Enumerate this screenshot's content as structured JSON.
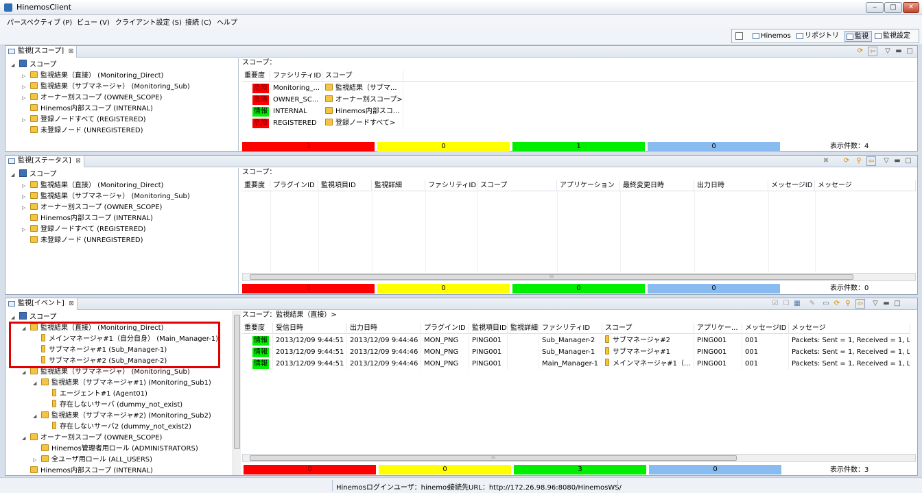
{
  "window": {
    "title": "HinemosClient",
    "min": "‒",
    "max": "□",
    "close": "✕"
  },
  "menu": [
    "パースペクティブ (P)",
    "ビュー (V)",
    "クライアント設定 (S)",
    "接続 (C)",
    "ヘルプ"
  ],
  "perspectives": [
    {
      "label": "Hinemos",
      "active": false
    },
    {
      "label": "リポジトリ",
      "active": false
    },
    {
      "label": "監視",
      "active": true
    },
    {
      "label": "監視設定",
      "active": false
    }
  ],
  "colors": {
    "critical": "#ff0000",
    "warning": "#ffff00",
    "info": "#00ee00",
    "unknown": "#88bbf0"
  },
  "view_close": "⊠",
  "scope_view": {
    "tab": "監視[スコープ]",
    "scope_label": "スコープ：",
    "tree": [
      {
        "label": "スコープ",
        "level": 0,
        "twist": "◢",
        "icon": "root"
      },
      {
        "label": "監視結果（直接） (Monitoring_Direct)",
        "level": 1,
        "twist": "▷",
        "icon": "folder"
      },
      {
        "label": "監視結果（サブマネージャ） (Monitoring_Sub)",
        "level": 1,
        "twist": "▷",
        "icon": "folder"
      },
      {
        "label": "オーナー別スコープ (OWNER_SCOPE)",
        "level": 1,
        "twist": "▷",
        "icon": "folder"
      },
      {
        "label": "Hinemos内部スコープ (INTERNAL)",
        "level": 1,
        "twist": "",
        "icon": "folder"
      },
      {
        "label": "登録ノードすべて (REGISTERED)",
        "level": 1,
        "twist": "▷",
        "icon": "folder"
      },
      {
        "label": "未登録ノード (UNREGISTERED)",
        "level": 1,
        "twist": "",
        "icon": "folder"
      }
    ],
    "columns": [
      "重要度",
      "ファシリティID",
      "スコープ"
    ],
    "rows": [
      {
        "severity": "危険",
        "sev_class": "red",
        "facility": "Monitoring_...",
        "scope": "監視結果（サブマ..."
      },
      {
        "severity": "危険",
        "sev_class": "red",
        "facility": "OWNER_SC...",
        "scope": "オーナー別スコープ>"
      },
      {
        "severity": "情報",
        "sev_class": "green",
        "facility": "INTERNAL",
        "scope": "Hinemos内部スコ..."
      },
      {
        "severity": "危険",
        "sev_class": "red",
        "facility": "REGISTERED",
        "scope": "登録ノードすべて>"
      }
    ],
    "counts": [
      "3",
      "0",
      "1",
      "0"
    ],
    "count_label": "表示件数：4"
  },
  "status_view": {
    "tab": "監視[ステータス]",
    "scope_label": "スコープ：",
    "tree": [
      {
        "label": "スコープ",
        "level": 0,
        "twist": "◢",
        "icon": "root"
      },
      {
        "label": "監視結果（直接） (Monitoring_Direct)",
        "level": 1,
        "twist": "▷",
        "icon": "folder"
      },
      {
        "label": "監視結果（サブマネージャ） (Monitoring_Sub)",
        "level": 1,
        "twist": "▷",
        "icon": "folder"
      },
      {
        "label": "オーナー別スコープ (OWNER_SCOPE)",
        "level": 1,
        "twist": "▷",
        "icon": "folder"
      },
      {
        "label": "Hinemos内部スコープ (INTERNAL)",
        "level": 1,
        "twist": "",
        "icon": "folder"
      },
      {
        "label": "登録ノードすべて (REGISTERED)",
        "level": 1,
        "twist": "▷",
        "icon": "folder"
      },
      {
        "label": "未登録ノード (UNREGISTERED)",
        "level": 1,
        "twist": "",
        "icon": "folder"
      }
    ],
    "columns": [
      "重要度",
      "プラグインID",
      "監視項目ID",
      "監視詳細",
      "ファシリティID",
      "スコープ",
      "アプリケーション",
      "最終変更日時",
      "出力日時",
      "メッセージID",
      "メッセージ"
    ],
    "counts": [
      "0",
      "0",
      "0",
      "0"
    ],
    "count_label": "表示件数：0",
    "scroll_thumb": "⁞⁞⁞"
  },
  "event_view": {
    "tab": "監視[イベント]",
    "scope_label": "スコープ：監視結果（直接）>",
    "tree": [
      {
        "label": "スコープ",
        "level": 0,
        "twist": "◢",
        "icon": "root"
      },
      {
        "label": "監視結果（直接） (Monitoring_Direct)",
        "level": 1,
        "twist": "◢",
        "icon": "folder"
      },
      {
        "label": "メインマネージャ#1（自分自身） (Main_Manager-1)",
        "level": 2,
        "twist": "",
        "icon": "node"
      },
      {
        "label": "サブマネージャ#1 (Sub_Manager-1)",
        "level": 2,
        "twist": "",
        "icon": "node"
      },
      {
        "label": "サブマネージャ#2 (Sub_Manager-2)",
        "level": 2,
        "twist": "",
        "icon": "node"
      },
      {
        "label": "監視結果（サブマネージャ） (Monitoring_Sub)",
        "level": 1,
        "twist": "◢",
        "icon": "folder"
      },
      {
        "label": "監視結果（サブマネージャ#1) (Monitoring_Sub1)",
        "level": 2,
        "twist": "◢",
        "icon": "folder"
      },
      {
        "label": "エージェント#1 (Agent01)",
        "level": 3,
        "twist": "",
        "icon": "node"
      },
      {
        "label": "存在しないサーバ (dummy_not_exist)",
        "level": 3,
        "twist": "",
        "icon": "node"
      },
      {
        "label": "監視結果（サブマネージャ#2) (Monitoring_Sub2)",
        "level": 2,
        "twist": "◢",
        "icon": "folder"
      },
      {
        "label": "存在しないサーバ2 (dummy_not_exist2)",
        "level": 3,
        "twist": "",
        "icon": "node"
      },
      {
        "label": "オーナー別スコープ (OWNER_SCOPE)",
        "level": 1,
        "twist": "◢",
        "icon": "folder"
      },
      {
        "label": "Hinemos管理者用ロール (ADMINISTRATORS)",
        "level": 2,
        "twist": "",
        "icon": "folder"
      },
      {
        "label": "全ユーザ用ロール (ALL_USERS)",
        "level": 2,
        "twist": "▷",
        "icon": "folder"
      },
      {
        "label": "Hinemos内部スコープ (INTERNAL)",
        "level": 1,
        "twist": "",
        "icon": "folder"
      }
    ],
    "columns": [
      "重要度",
      "受信日時",
      "出力日時",
      "プラグインID",
      "監視項目ID",
      "監視詳細",
      "ファシリティID",
      "スコープ",
      "アプリケー...",
      "メッセージID",
      "メッセージ"
    ],
    "rows": [
      {
        "severity": "情報",
        "received": "2013/12/09 9:44:51",
        "output": "2013/12/09 9:44:46",
        "plugin": "MON_PNG",
        "item": "PING001",
        "detail": "",
        "facility": "Sub_Manager-2",
        "scope": "サブマネージャ#2",
        "app": "PING001",
        "msgid": "001",
        "message": "Packets: Sent = 1, Received = 1, L..."
      },
      {
        "severity": "情報",
        "received": "2013/12/09 9:44:51",
        "output": "2013/12/09 9:44:46",
        "plugin": "MON_PNG",
        "item": "PING001",
        "detail": "",
        "facility": "Sub_Manager-1",
        "scope": "サブマネージャ#1",
        "app": "PING001",
        "msgid": "001",
        "message": "Packets: Sent = 1, Received = 1, L..."
      },
      {
        "severity": "情報",
        "received": "2013/12/09 9:44:51",
        "output": "2013/12/09 9:44:46",
        "plugin": "MON_PNG",
        "item": "PING001",
        "detail": "",
        "facility": "Main_Manager-1",
        "scope": "メインマネージャ#1（...",
        "app": "PING001",
        "msgid": "001",
        "message": "Packets: Sent = 1, Received = 1, L..."
      }
    ],
    "counts": [
      "0",
      "0",
      "3",
      "0"
    ],
    "count_label": "表示件数：3",
    "scroll_thumb": "⁞⁞⁞"
  },
  "statusbar": {
    "login": "Hinemosログインユーザ：hinemos",
    "url": "接続先URL：http://172.26.98.96:8080/HinemosWS/"
  }
}
